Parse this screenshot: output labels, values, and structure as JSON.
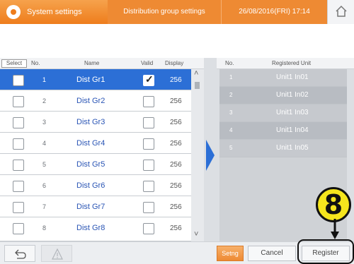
{
  "header": {
    "system_settings": "System settings",
    "screen_title": "Distribution group settings",
    "datetime": "26/08/2016(FRI) 17:14"
  },
  "left_list": {
    "columns": {
      "select": "Select",
      "no": "No.",
      "name": "Name",
      "valid": "Valid",
      "display": "Display"
    },
    "rows": [
      {
        "no": "1",
        "name": "Dist Gr1",
        "valid": true,
        "display": "256",
        "selected": true
      },
      {
        "no": "2",
        "name": "Dist Gr2",
        "valid": false,
        "display": "256",
        "selected": false
      },
      {
        "no": "3",
        "name": "Dist Gr3",
        "valid": false,
        "display": "256",
        "selected": false
      },
      {
        "no": "4",
        "name": "Dist Gr4",
        "valid": false,
        "display": "256",
        "selected": false
      },
      {
        "no": "5",
        "name": "Dist Gr5",
        "valid": false,
        "display": "256",
        "selected": false
      },
      {
        "no": "6",
        "name": "Dist Gr6",
        "valid": false,
        "display": "256",
        "selected": false
      },
      {
        "no": "7",
        "name": "Dist Gr7",
        "valid": false,
        "display": "256",
        "selected": false
      },
      {
        "no": "8",
        "name": "Dist Gr8",
        "valid": false,
        "display": "256",
        "selected": false
      }
    ]
  },
  "right_list": {
    "columns": {
      "no": "No.",
      "registered_unit": "Registered Unit"
    },
    "rows": [
      {
        "no": "1",
        "unit": "Unit1 In01"
      },
      {
        "no": "2",
        "unit": "Unit1 In02"
      },
      {
        "no": "3",
        "unit": "Unit1 In03"
      },
      {
        "no": "4",
        "unit": "Unit1 In04"
      },
      {
        "no": "5",
        "unit": "Unit1 In05"
      }
    ]
  },
  "footer": {
    "setng": "Setng",
    "cancel": "Cancel",
    "register": "Register"
  },
  "annotation": {
    "step_number": "8"
  },
  "colors": {
    "header_orange": "#ee8a33",
    "selected_row_blue": "#2c6fd6",
    "badge_yellow": "#f5e51d"
  }
}
